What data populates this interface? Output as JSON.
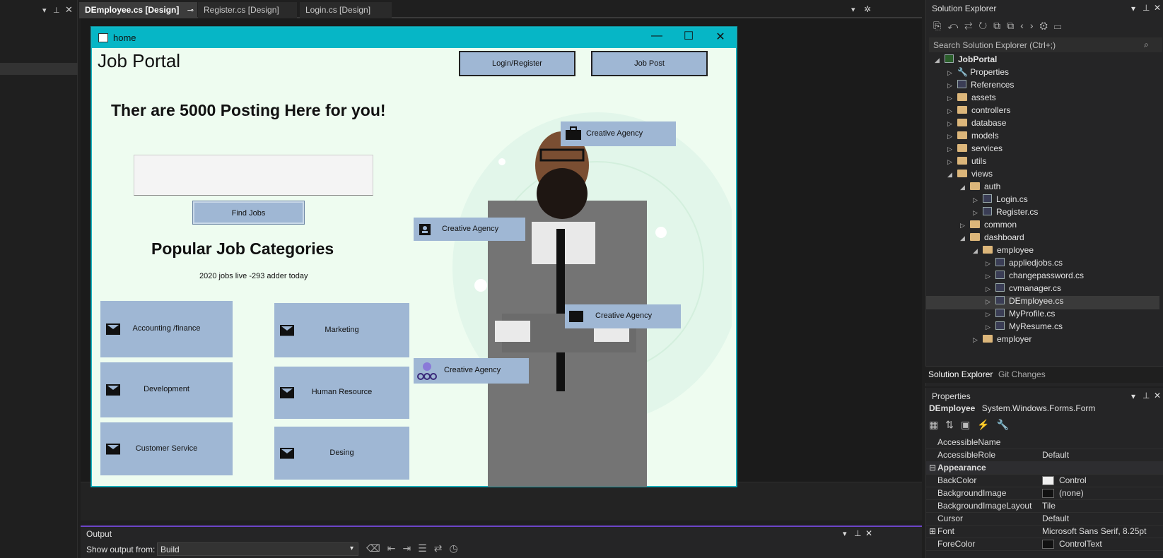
{
  "tabs": [
    {
      "label": "DEmployee.cs [Design]",
      "active": true
    },
    {
      "label": "Register.cs [Design]"
    },
    {
      "label": "Login.cs [Design]"
    }
  ],
  "form": {
    "window_title": "home",
    "app_title": "Job Portal",
    "login_button": "Login/Register",
    "jobpost_button": "Job Post",
    "headline": "Ther are 5000 Posting Here for you!",
    "search_value": "",
    "find_button": "Find Jobs",
    "categories_title": "Popular Job Categories",
    "jobs_live": "2020  jobs live -293 adder today",
    "categories": [
      "Accounting /finance",
      "Development",
      "Customer Service",
      "Marketing",
      "Human Resource",
      "Desing"
    ],
    "tags": [
      "Creative Agency",
      "Creative Agency",
      "Creative Agency",
      "Creative Agency"
    ]
  },
  "solution_explorer": {
    "title": "Solution Explorer",
    "search_placeholder": "Search Solution Explorer (Ctrl+;)",
    "tree": [
      "JobPortal",
      "Properties",
      "References",
      "assets",
      "controllers",
      "database",
      "models",
      "services",
      "utils",
      "views",
      "auth",
      "Login.cs",
      "Register.cs",
      "common",
      "dashboard",
      "employee",
      "appliedjobs.cs",
      "changepassword.cs",
      "cvmanager.cs",
      "DEmployee.cs",
      "MyProfile.cs",
      "MyResume.cs",
      "employer"
    ],
    "bottom_tabs": [
      "Solution Explorer",
      "Git Changes"
    ]
  },
  "properties": {
    "title": "Properties",
    "object": "DEmployee",
    "object_type": "System.Windows.Forms.Form",
    "rows": [
      {
        "k": "AccessibleName",
        "v": ""
      },
      {
        "k": "AccessibleRole",
        "v": "Default"
      },
      {
        "k": "Appearance",
        "v": "",
        "cat": true
      },
      {
        "k": "BackColor",
        "v": "Control"
      },
      {
        "k": "BackgroundImage",
        "v": "(none)"
      },
      {
        "k": "BackgroundImageLayout",
        "v": "Tile"
      },
      {
        "k": "Cursor",
        "v": "Default"
      },
      {
        "k": "Font",
        "v": "Microsoft Sans Serif, 8.25pt"
      },
      {
        "k": "ForeColor",
        "v": "ControlText"
      }
    ]
  },
  "output": {
    "title": "Output",
    "show_label": "Show output from:",
    "source": "Build"
  }
}
